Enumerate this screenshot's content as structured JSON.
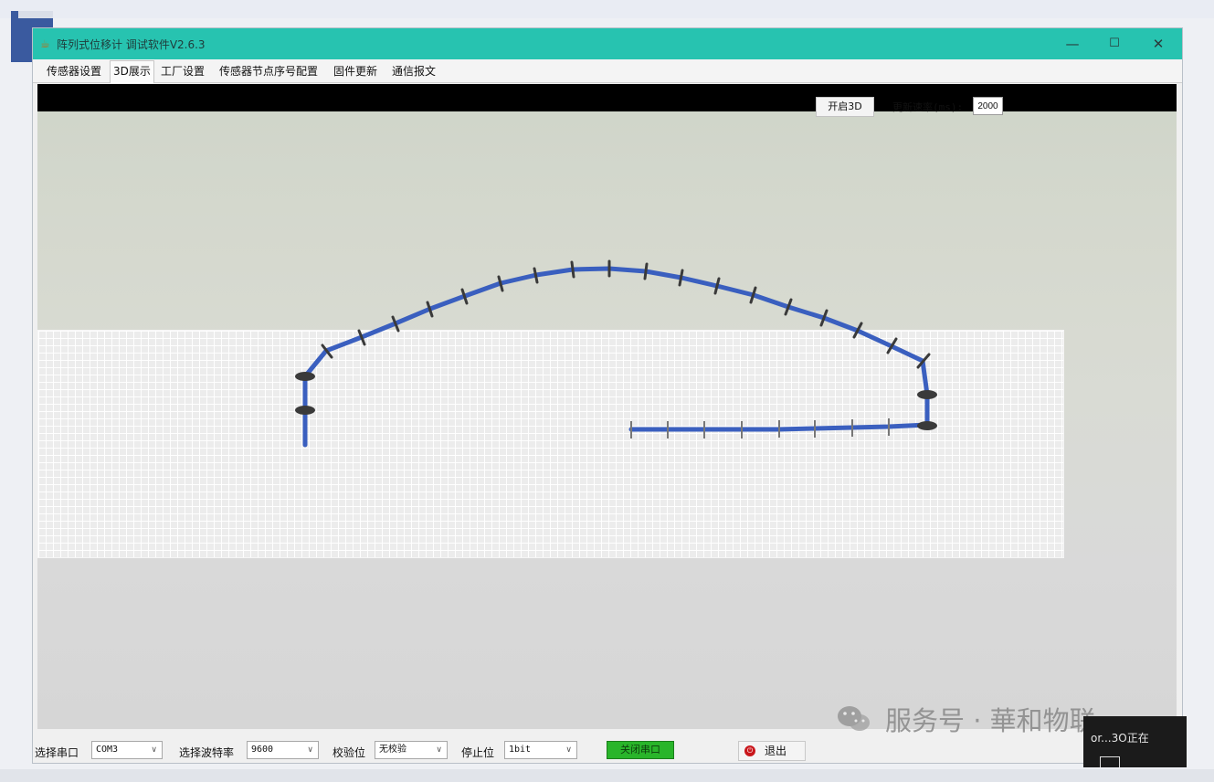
{
  "window": {
    "title": "阵列式位移计 调试软件V2.6.3",
    "controls": {
      "minimize": "—",
      "maximize": "☐",
      "close": "✕"
    }
  },
  "tabs": [
    {
      "label": "传感器设置",
      "active": false
    },
    {
      "label": "3D展示",
      "active": true
    },
    {
      "label": "工厂设置",
      "active": false
    },
    {
      "label": "传感器节点序号配置",
      "active": false
    },
    {
      "label": "固件更新",
      "active": false
    },
    {
      "label": "通信报文",
      "active": false
    }
  ],
  "viewer": {
    "open3d_label": "开启3D",
    "refresh_rate_label": "更新速率(ms):",
    "refresh_rate_value": "2000"
  },
  "statusbar": {
    "port_label": "选择串口",
    "port_value": "COM3",
    "baud_label": "选择波特率",
    "baud_value": "9600",
    "parity_label": "校验位",
    "parity_value": "无校验",
    "stopbit_label": "停止位",
    "stopbit_value": "1bit",
    "close_port_label": "关闭串口",
    "exit_label": "退出"
  },
  "watermark": {
    "text": "服务号 · 華和物联"
  },
  "notification": {
    "text": "or...3O正在"
  },
  "colors": {
    "titlebar": "#27c3b0",
    "sensor_chain": "#3a5fbf",
    "port_open_button": "#29b52a",
    "exit_icon": "#c9161b",
    "viewport_top": "#000000"
  }
}
